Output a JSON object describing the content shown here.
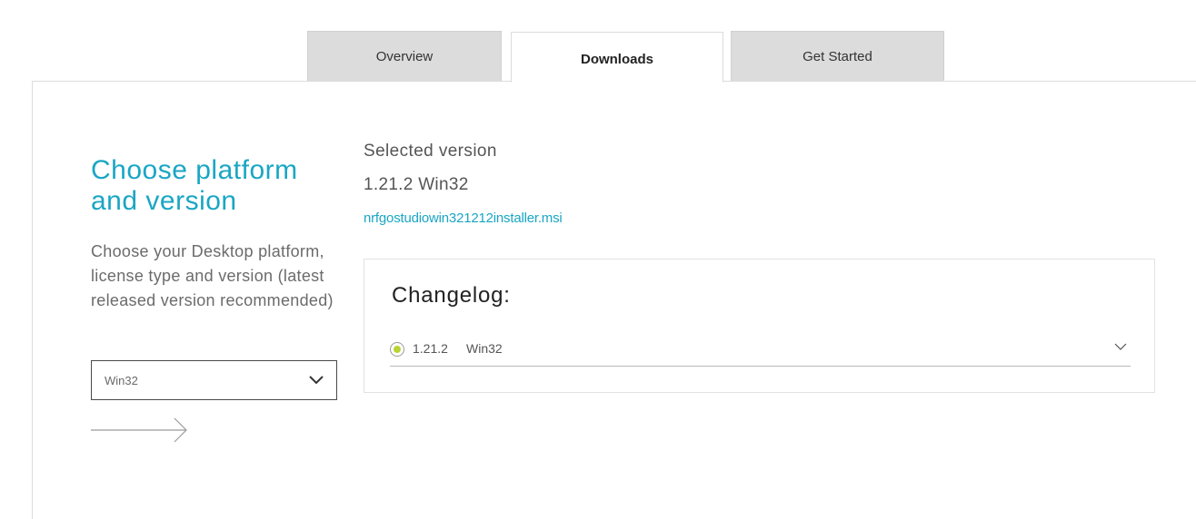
{
  "tabs": [
    {
      "label": "Overview",
      "active": false
    },
    {
      "label": "Downloads",
      "active": true
    },
    {
      "label": "Get Started",
      "active": false
    }
  ],
  "left": {
    "heading": "Choose platform and version",
    "description": "Choose your Desktop platform, license type and version (latest released version recommended)",
    "platform_select": {
      "value": "Win32",
      "icon": "chevron-down-icon"
    },
    "arrow_icon": "arrow-right-icon"
  },
  "selected": {
    "label": "Selected version",
    "version": "1.21.2 Win32",
    "file_link": "nrfgostudiowin321212installer.msi"
  },
  "changelog": {
    "title": "Changelog:",
    "items": [
      {
        "version": "1.21.2",
        "platform": "Win32",
        "selected": true,
        "icon": "chevron-down-icon"
      }
    ]
  },
  "colors": {
    "accent": "#1aa6c4",
    "radio_selected": "#b8d432",
    "tab_inactive_bg": "#dcdcdc"
  }
}
